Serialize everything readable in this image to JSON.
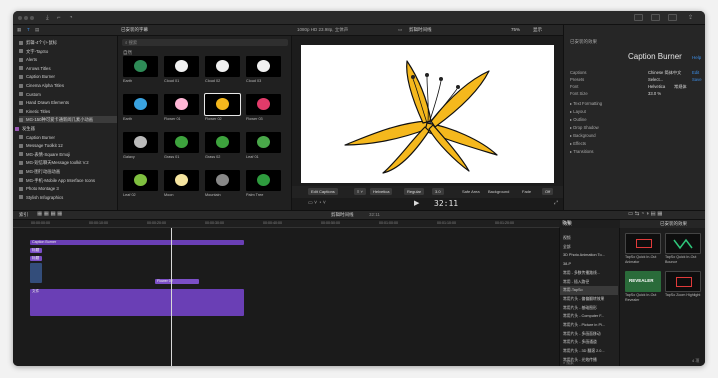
{
  "window": {
    "timecode": "32:11"
  },
  "row2": {
    "library_title": "已安装的字幕",
    "viewer_info": "1080p HD 23.98p, 立体声",
    "viewer_clip": "剪辑时间线",
    "zoom": "75%",
    "view": "显示",
    "inspector_title": "Caption Burner",
    "inspector_duration": "40:18"
  },
  "library": {
    "items": [
      {
        "label": "剪辑-4个小-鼠标",
        "type": "item"
      },
      {
        "label": "文字-TapSo",
        "type": "item"
      },
      {
        "label": "Alerts",
        "type": "item"
      },
      {
        "label": "Arrows Titles",
        "type": "item"
      },
      {
        "label": "Caption Burner",
        "type": "item"
      },
      {
        "label": "Cinema Alpha Titles",
        "type": "item"
      },
      {
        "label": "Custom",
        "type": "item"
      },
      {
        "label": "Hand Drawn Elements",
        "type": "item"
      },
      {
        "label": "Kinetic Titles",
        "type": "item"
      },
      {
        "label": "MG-150种可爱卡通新闻几素小动画",
        "type": "sel"
      },
      {
        "label": "发生器",
        "type": "hdr"
      },
      {
        "label": "Caption Burner",
        "type": "item"
      },
      {
        "label": "Message Toolkit 12",
        "type": "item"
      },
      {
        "label": "MG-表情-Square Emoji",
        "type": "item"
      },
      {
        "label": "MG-短信聊天Message toolkit V.2",
        "type": "item"
      },
      {
        "label": "MG-图行动画动画",
        "type": "item"
      },
      {
        "label": "MG-手机-Mobile App Interface Icons",
        "type": "item"
      },
      {
        "label": "Photo Montage 3",
        "type": "item"
      },
      {
        "label": "Stylish Infographics",
        "type": "item"
      }
    ]
  },
  "browser": {
    "search_placeholder": "搜索",
    "section": "自然",
    "thumbs": [
      "Earth",
      "Cloud 01",
      "Cloud 02",
      "Cloud 03",
      "Earth",
      "Flower 01",
      "Flower 02",
      "Flower 03",
      "Galaxy",
      "Grass 01",
      "Grass 02",
      "Leaf 01",
      "Leaf 02",
      "Moon",
      "Mountain",
      "Palm Tree"
    ]
  },
  "captionbar": {
    "edit": "Edit Captions",
    "font": "Helvetica",
    "style": "Regular",
    "size": "3.0",
    "safe_area": "Safe Area",
    "background": "Background",
    "fade": "Fade",
    "off": "Off"
  },
  "inspector": {
    "section": "已安装的效果",
    "title": "Caption Burner",
    "help": "Help",
    "rows": [
      {
        "label": "Captions",
        "value": "Chinese 简体中文",
        "action": "Edit"
      },
      {
        "label": "Presets",
        "value": "Select...",
        "action": "Save"
      },
      {
        "label": "Font",
        "value": "Helvetica",
        "value2": "常规体"
      },
      {
        "label": "Font Size",
        "value": "33.0 %"
      }
    ],
    "groups": [
      "Text Formatting",
      "Layout",
      "Outline",
      "Drop Shadow",
      "Background",
      "Effects",
      "Transitions"
    ]
  },
  "timeline": {
    "label": "索引",
    "clip_title": "剪辑时间线",
    "clip_duration": "32:11",
    "ruler": [
      "00:00:00:00",
      "00:00:10:00",
      "00:00:20:00",
      "00:00:30:00",
      "00:00:40:00",
      "00:00:50:00",
      "00:01:00:00",
      "00:01:10:00",
      "00:01:20:00"
    ],
    "clips": [
      "Caption Burner",
      "标题",
      "标题",
      "Flower 02",
      "文件"
    ]
  },
  "effects_list": {
    "title": "效果",
    "items": [
      "视频",
      "全部",
      "3D Photo Animation To...",
      "38-P",
      "常用 - 多数传播路线...",
      "常用 - 插入路径",
      "常用-TapSo",
      "常用片头 - 偏偏翻转效果",
      "常用片头 - 基础图形",
      "常用片头 - Computer F...",
      "常用片头 - Picture in Pi...",
      "常用片头 - 多画面移动",
      "常用片头 - 多画通道",
      "常用片头 - 3D 翻滚 2.0...",
      "常用片头 - 光效传播"
    ],
    "search": "搜索"
  },
  "effects_panel": {
    "title": "已安装的效果",
    "items": [
      "TapSo Quick In-Out Animator",
      "TapSo Quick In-Out Bounce",
      "TapSo Quick In-Out Revealer",
      "TapSo Zoom Highlight"
    ],
    "revealer": "REVEALER",
    "count": "4 项"
  }
}
